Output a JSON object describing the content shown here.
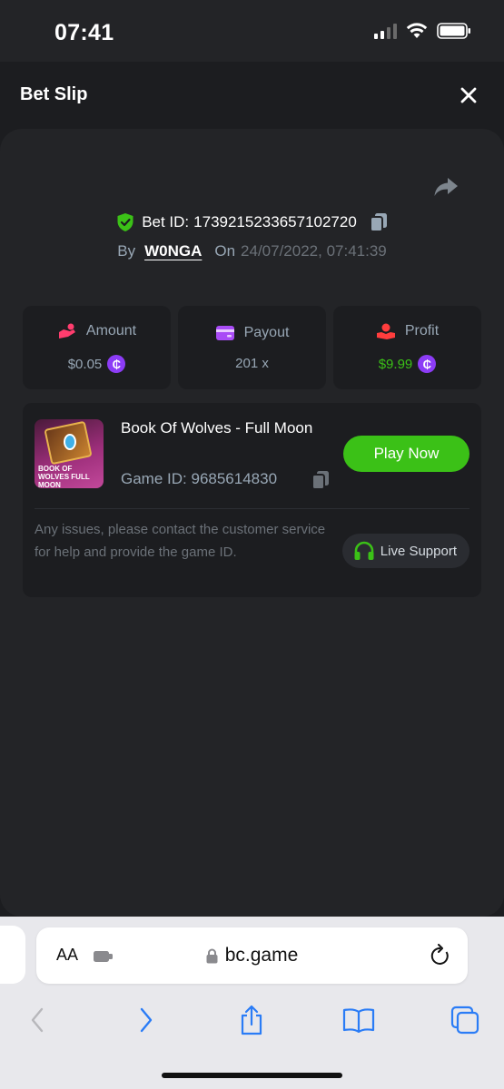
{
  "status_bar": {
    "time": "07:41"
  },
  "header": {
    "title": "Bet Slip"
  },
  "bet": {
    "id_label": "Bet ID:",
    "id_value": "1739215233657102720",
    "by_label": "By",
    "user": "W0NGA",
    "on_label": "On",
    "date": "24/07/2022, 07:41:39"
  },
  "stats": {
    "amount": {
      "label": "Amount",
      "value": "$0.05"
    },
    "payout": {
      "label": "Payout",
      "value": "201 x"
    },
    "profit": {
      "label": "Profit",
      "value": "$9.99"
    }
  },
  "game": {
    "name": "Book Of Wolves - Full Moon",
    "id_label": "Game ID:",
    "id_value": "9685614830",
    "thumb_text": "BOOK OF WOLVES FULL MOON",
    "play_label": "Play Now",
    "issue_text": "Any issues, please contact the customer service for help and provide the game ID.",
    "support_label": "Live Support"
  },
  "browser": {
    "text_size_label": "AA",
    "url": "bc.game"
  },
  "colors": {
    "accent_green": "#3bc117",
    "coin_purple": "#8c3cf6",
    "background": "#232427",
    "card": "#1c1d20"
  },
  "icons": [
    "signal-icon",
    "wifi-icon",
    "battery-icon",
    "close-icon",
    "share-icon",
    "shield-check-icon",
    "copy-icon",
    "amount-icon",
    "payout-icon",
    "profit-icon",
    "coin-icon",
    "headset-icon",
    "extension-icon",
    "lock-icon",
    "reload-icon",
    "back-icon",
    "forward-icon",
    "share-sheet-icon",
    "bookmarks-icon",
    "tabs-icon"
  ]
}
